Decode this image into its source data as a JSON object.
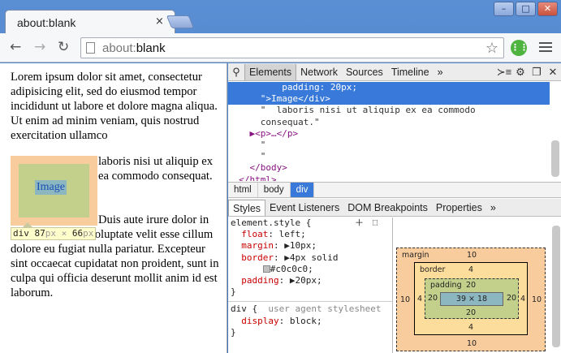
{
  "window": {
    "tab_title": "about:blank",
    "tab_close": "×",
    "minimize": "–",
    "maximize": "□",
    "close": "✕"
  },
  "toolbar": {
    "back": "←",
    "forward": "→",
    "reload": "↻",
    "url_scheme": "about:",
    "url_rest": "blank",
    "star": "☆"
  },
  "page": {
    "paragraph1": "Lorem ipsum dolor sit amet, consectetur adipisicing elit, sed do eiusmod tempor incididunt ut labore et dolore magna aliqua. Ut enim ad minim veniam, quis nostrud exercitation ullamco",
    "image_text": "Image",
    "paragraph2": "laboris nisi ut aliquip ex ea commodo consequat.",
    "paragraph3": "Duis aute irure dolor in reprehenderit in voluptate velit esse cillum dolore eu fugiat nulla pariatur. Excepteur sint occaecat cupidatat non proident, sunt in culpa qui officia deserunt mollit anim id est laborum.",
    "tooltip_tag": "div",
    "tooltip_w": "87",
    "tooltip_h": "66",
    "tooltip_unit": "px",
    "tooltip_x": "×"
  },
  "devtools": {
    "tabs": [
      "Elements",
      "Network",
      "Sources",
      "Timeline"
    ],
    "more": "»",
    "elements_lines": [
      "          padding: 20px;",
      "      \">Image</div>",
      "      \"  laboris nisi ut aliquip ex ea commodo",
      "      consequat.\"",
      "    ▶<p>…</p>",
      "      \"",
      "      \"",
      "    </body>",
      "  </html>"
    ],
    "breadcrumbs": [
      "html",
      "body",
      "div"
    ],
    "subtabs": [
      "Styles",
      "Event Listeners",
      "DOM Breakpoints",
      "Properties"
    ],
    "styles": {
      "selector": "element.style {",
      "float_name": "float",
      "float_val": "left;",
      "margin_name": "margin",
      "margin_val": "10px;",
      "border_name": "border",
      "border_val": "4px solid",
      "border_color": "#c0c0c0;",
      "padding_name": "padding",
      "padding_val": "20px;",
      "close": "}",
      "ua_selector": "div {",
      "ua_label": "user agent stylesheet",
      "display_name": "display",
      "display_val": "block;",
      "ua_close": "}"
    },
    "boxmodel": {
      "margin_label": "margin",
      "margin_top": "10",
      "margin_bottom": "10",
      "margin_left": "10",
      "margin_right": "10",
      "border_label": "border",
      "border_top": "4",
      "border_bottom": "4",
      "border_left": "4",
      "border_right": "4",
      "padding_label": "padding",
      "padding_top": "20",
      "padding_bottom": "20",
      "padding_left": "20",
      "padding_right": "20",
      "content": "39 × 18"
    }
  },
  "colors": {
    "selection": "#3879d9",
    "margin": "#f9cc9d",
    "padding": "#c3d08b",
    "content": "#8cb6c0"
  }
}
